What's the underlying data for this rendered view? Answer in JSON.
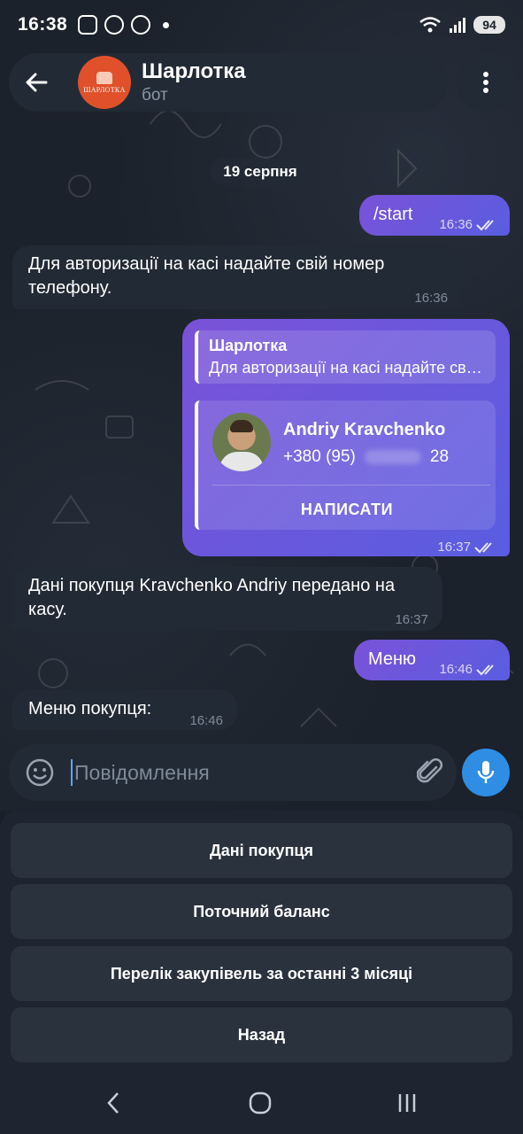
{
  "status_bar": {
    "time": "16:38",
    "battery": "94"
  },
  "header": {
    "name": "Шарлотка",
    "subtitle": "бот",
    "avatar_text": "ШАРЛОТКА"
  },
  "chat": {
    "date": "19 серпня",
    "messages": [
      {
        "dir": "out",
        "text": "/start",
        "time": "16:36"
      },
      {
        "dir": "in",
        "text": "Для авторизації на касі надайте свій номер телефону.",
        "time": "16:36"
      },
      {
        "dir": "out",
        "time": "16:37",
        "reply": {
          "name": "Шарлотка",
          "text": "Для авторизації на касі надайте свій номер телефону."
        },
        "contact": {
          "name": "Andriy Kravchenko",
          "phone_prefix": "+380 (95)",
          "phone_suffix": "28",
          "action": "НАПИСАТИ"
        }
      },
      {
        "dir": "in",
        "text": "Дані покупця Kravchenko Andriy передано на касу.",
        "time": "16:37"
      },
      {
        "dir": "out",
        "text": "Меню",
        "time": "16:46"
      },
      {
        "dir": "in",
        "text": "Меню покупця:",
        "time": "16:46"
      }
    ]
  },
  "input": {
    "placeholder": "Повідомлення"
  },
  "keyboard": {
    "buttons": [
      "Дані покупця",
      "Поточний баланс",
      "Перелік закупівель за останні 3 місяці",
      "Назад"
    ]
  },
  "icons": {
    "back": "arrow-left-icon",
    "menu": "more-vertical-icon",
    "emoji": "emoji-icon",
    "attach": "paperclip-icon",
    "mic": "microphone-icon",
    "checks": "double-check-icon"
  },
  "colors": {
    "accent": "#2f8de4",
    "outgoing": "#6c55dc",
    "incoming": "#222a35"
  }
}
